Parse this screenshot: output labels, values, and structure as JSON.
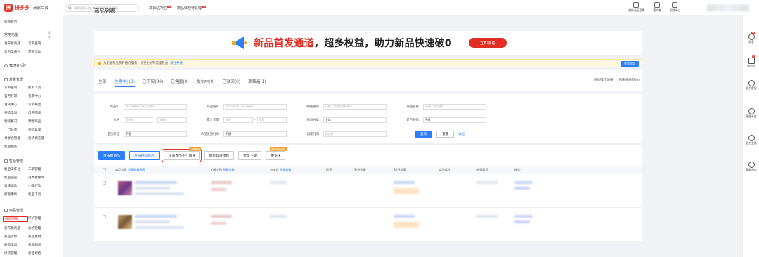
{
  "topbar": {
    "logo_mark": "拼",
    "logo_text": "拼多多",
    "logo_sub": "商家后台",
    "search_placeholder": "搜索功能/订单/商品/课程/规则/帮助",
    "links": [
      {
        "label": "来源站内信",
        "badge": "9"
      },
      {
        "label": "商品体检待处理",
        "badge": "9"
      }
    ],
    "icons": [
      {
        "name": "shop-icon",
        "label": "店铺/社区团购"
      },
      {
        "name": "service-icon",
        "label": "客户端"
      },
      {
        "name": "help-icon",
        "label": "规则中心"
      }
    ]
  },
  "sidebar": {
    "home": "后台首页",
    "common": {
      "title": "常用功能",
      "edit": "管理",
      "items": [
        "发布新商品",
        "订单查询",
        "售后工作台",
        "营销活动"
      ]
    },
    "temu": "TEMU入驻",
    "shipping": {
      "title": "发货管理",
      "items": [
        "订单查询",
        "打单工具",
        "官方打印",
        "包裹中心",
        "发货中心",
        "订单导出",
        "物流工具",
        "电子面单",
        "物流概况",
        "预售商品",
        "上门验货",
        "物流异常",
        "共享仓管理",
        "发货优先级",
        "售后服务"
      ]
    },
    "aftersale": {
      "title": "售后管理",
      "items": [
        "售后工作台",
        "工单管理",
        "售后设置",
        "消费者保障",
        "极速退款",
        "小额打款",
        "打假申诉",
        "售后工具"
      ]
    },
    "goods": {
      "title": "商品管理",
      "items": [
        "商品列表",
        "评价管理",
        "发布新商品",
        "价格管理",
        "商品诊断",
        "商品素材",
        "商品工具",
        "机会商品",
        "供货管理",
        "商品规格"
      ]
    }
  },
  "page": {
    "title": "商品列表"
  },
  "banner": {
    "part1": "新品首发通道",
    "part2": "，超多权益，助力新品快速破0",
    "button": "立即前往"
  },
  "notice": {
    "text": "为您推荐免费开通的服务，享受更好的流量权益",
    "link": "前往开通",
    "button": "查看全部"
  },
  "tabs": {
    "items": [
      "全部",
      "在售中(13)",
      "已下架(88)",
      "已售罄(0)",
      "发布中(0)",
      "已驳回(0)",
      "草稿箱(1)"
    ],
    "active_index": 1,
    "right": [
      "商品操作记录",
      "已删除商品(0)"
    ]
  },
  "filters": {
    "row1": [
      {
        "label": "商品ID",
        "placeholder": "多个请在输入框回车输入"
      },
      {
        "label": "商品编码",
        "placeholder": "多个请在输入框回车输入"
      },
      {
        "label": "规格编码",
        "placeholder": "请输入完整的规格编码"
      },
      {
        "label": "商品名称",
        "placeholder": "请输入商品名称"
      }
    ],
    "row2": [
      {
        "label": "价格",
        "from": "最低价",
        "to": "最高价"
      },
      {
        "label": "累计销量",
        "from": "最低",
        "to": "最高"
      },
      {
        "label": "商品分类",
        "value": "全部"
      },
      {
        "label": "是否预售",
        "value": "不限"
      }
    ],
    "row3": [
      {
        "label": "是否新品",
        "value": "不限"
      },
      {
        "label": "承诺发货时间",
        "value": "不限"
      },
      {
        "label": "创建时间",
        "placeholder": "请选择"
      }
    ],
    "search": "查询",
    "reset": "重置",
    "collapse": "收起"
  },
  "actions": {
    "publish": "发布新商品",
    "publish_similar": "发布相似商品",
    "set_holiday": "设置春节不打烊",
    "set_holiday_tag": "设置营销",
    "batch_cancel": "批量取消预售",
    "batch_off": "批量下架",
    "more": "更多",
    "more_tag": "操作批量编辑"
  },
  "table": {
    "headers": [
      {
        "label": "商品信息",
        "extra": "批量修改标题"
      },
      {
        "label": "价格(元)",
        "extra": "批量修改"
      },
      {
        "label": "总库存",
        "extra": "批量修改"
      },
      {
        "label": "运费"
      },
      {
        "label": "累计销量"
      },
      {
        "label": "30日销量"
      },
      {
        "label": "商品体检"
      },
      {
        "label": "创建时间"
      },
      {
        "label": "操作"
      }
    ]
  },
  "rightrail": [
    {
      "label": "消息",
      "badge": "99"
    },
    {
      "label": "站内信",
      "badge": "9"
    },
    {
      "label": "官方客服"
    },
    {
      "label": "客服平台"
    },
    {
      "label": "官方会话"
    },
    {
      "label": "帮助中心"
    }
  ]
}
